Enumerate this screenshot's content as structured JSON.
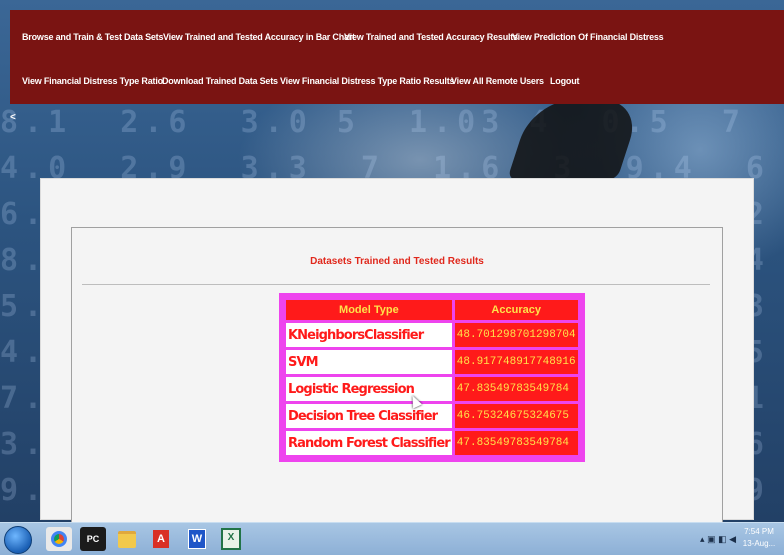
{
  "nav": {
    "row1": [
      "Browse and Train & Test Data Sets",
      "View Trained and Tested Accuracy in Bar Chart",
      "View Trained and Tested Accuracy Results",
      "View Prediction Of Financial Distress"
    ],
    "row2": [
      "View Financial Distress Type Ratio",
      "Download Trained Data Sets",
      "View Financial Distress Type Ratio Results",
      "View All Remote Users",
      "Logout"
    ],
    "back_symbol": "<"
  },
  "panel": {
    "title": "Datasets Trained and Tested Results"
  },
  "table": {
    "headers": [
      "Model Type",
      "Accuracy"
    ],
    "rows": [
      {
        "model": "KNeighborsClassifier",
        "accuracy": "48.701298701298704"
      },
      {
        "model": "SVM",
        "accuracy": "48.917748917748916"
      },
      {
        "model": "Logistic Regression",
        "accuracy": "47.83549783549784"
      },
      {
        "model": "Decision Tree Classifier",
        "accuracy": "46.75324675324675"
      },
      {
        "model": "Random Forest Classifier",
        "accuracy": "47.83549783549784"
      }
    ]
  },
  "taskbar": {
    "apps": [
      "start-button",
      "chrome-icon",
      "pycharm-icon",
      "folder-icon",
      "pdf-icon",
      "word-icon",
      "excel-icon"
    ],
    "pycharm_label": "PC",
    "pdf_label": "A",
    "word_label": "W",
    "excel_label": "X",
    "clock_time": "7:54 PM",
    "clock_date": "13-Aug..."
  },
  "colors": {
    "nav_bg": "#7a1412",
    "title_red": "#e0281c",
    "cell_red": "#ff1a1a",
    "cell_yellow": "#ffe24a",
    "table_border": "#ee44ee"
  }
}
